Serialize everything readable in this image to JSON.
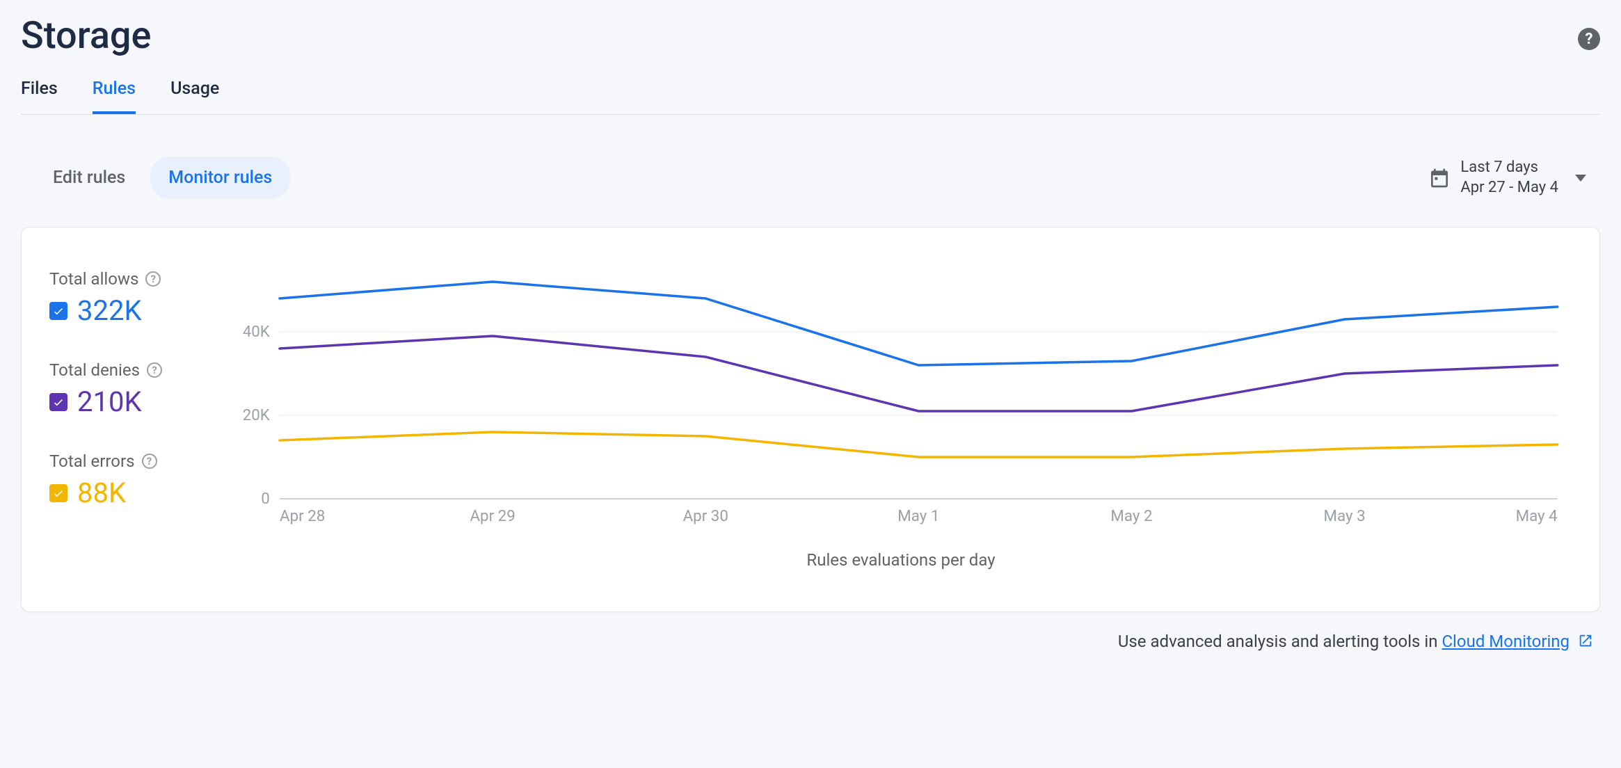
{
  "page_title": "Storage",
  "top_tabs": {
    "files": "Files",
    "rules": "Rules",
    "usage": "Usage",
    "active": "rules"
  },
  "sub_tabs": {
    "edit": "Edit rules",
    "monitor": "Monitor rules",
    "active": "monitor"
  },
  "date_picker": {
    "range_label": "Last 7 days",
    "range_value": "Apr 27 - May 4"
  },
  "legend": {
    "allows": {
      "label": "Total allows",
      "value": "322K",
      "color": "#1a73e8"
    },
    "denies": {
      "label": "Total denies",
      "value": "210K",
      "color": "#5e35b1"
    },
    "errors": {
      "label": "Total errors",
      "value": "88K",
      "color": "#f2b600"
    }
  },
  "footer": {
    "text": "Use advanced analysis and alerting tools in ",
    "link": "Cloud Monitoring"
  },
  "chart_data": {
    "type": "line",
    "title": "",
    "xlabel": "Rules evaluations per day",
    "ylabel": "",
    "ylim": [
      0,
      55000
    ],
    "y_ticks": [
      0,
      20000,
      40000
    ],
    "y_tick_labels": [
      "0",
      "20K",
      "40K"
    ],
    "categories": [
      "Apr 28",
      "Apr 29",
      "Apr 30",
      "May 1",
      "May 2",
      "May 3",
      "May 4"
    ],
    "series": [
      {
        "name": "Total allows",
        "color": "#1a73e8",
        "values": [
          48000,
          52000,
          48000,
          32000,
          33000,
          43000,
          46000
        ]
      },
      {
        "name": "Total denies",
        "color": "#5e35b1",
        "values": [
          36000,
          39000,
          34000,
          21000,
          21000,
          30000,
          32000
        ]
      },
      {
        "name": "Total errors",
        "color": "#f2b600",
        "values": [
          14000,
          16000,
          15000,
          10000,
          10000,
          12000,
          13000
        ]
      }
    ]
  }
}
